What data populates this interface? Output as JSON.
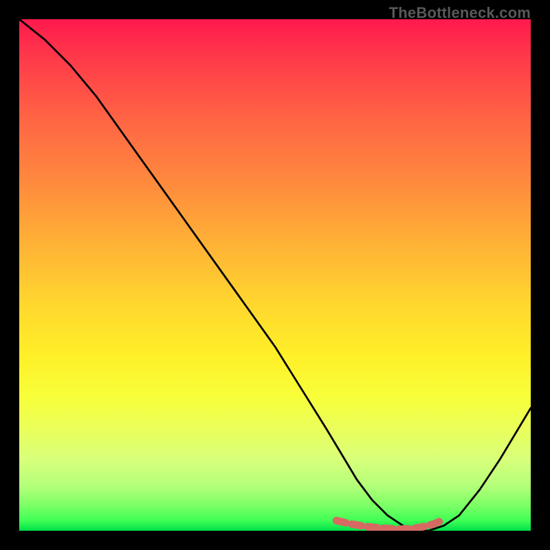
{
  "watermark": "TheBottleneck.com",
  "chart_data": {
    "type": "line",
    "title": "",
    "xlabel": "",
    "ylabel": "",
    "xlim": [
      0,
      100
    ],
    "ylim": [
      0,
      100
    ],
    "grid": false,
    "series": [
      {
        "name": "main-curve",
        "color": "#000000",
        "x": [
          0,
          5,
          10,
          15,
          20,
          25,
          30,
          35,
          40,
          45,
          50,
          55,
          60,
          63,
          66,
          69,
          72,
          75,
          78,
          80,
          83,
          86,
          90,
          94,
          100
        ],
        "y": [
          100,
          96,
          91,
          85,
          78,
          71,
          64,
          57,
          50,
          43,
          36,
          28,
          20,
          15,
          10,
          6,
          3,
          1,
          0,
          0,
          1,
          3,
          8,
          14,
          24
        ]
      },
      {
        "name": "marker-band",
        "color": "#d66a63",
        "x": [
          62,
          65,
          68,
          71,
          74,
          77,
          79,
          81,
          83
        ],
        "y": [
          2,
          1.3,
          0.8,
          0.5,
          0.3,
          0.4,
          0.8,
          1.3,
          2.2
        ]
      }
    ]
  }
}
